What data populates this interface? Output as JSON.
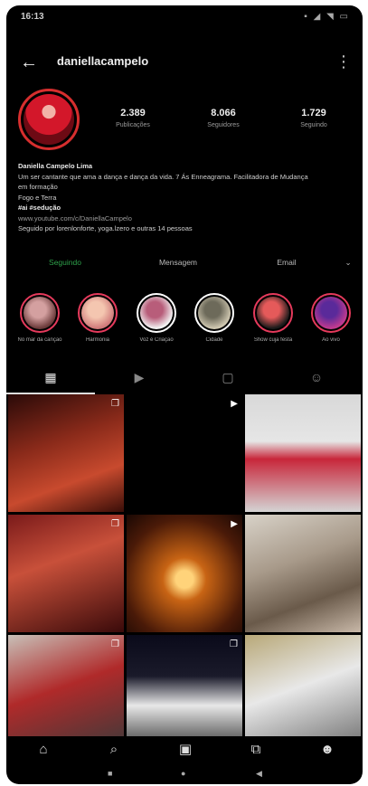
{
  "status_bar": {
    "time": "16:13",
    "icons": "▪ ◢ ◥ ▭"
  },
  "header": {
    "back_icon": "←",
    "username": "daniellacampelo",
    "menu_icon": "⋮"
  },
  "stats": [
    {
      "value": "2.389",
      "label": "Publicações"
    },
    {
      "value": "8.066",
      "label": "Seguidores"
    },
    {
      "value": "1.729",
      "label": "Seguindo"
    }
  ],
  "bio": {
    "name": "Daniella Campelo Lima",
    "lines": [
      "Um ser cantante que ama a dança e dança da vida. 7 Ás Enneagrama. Facilitadora de Mudança",
      "em formação",
      "Fogo e Terra"
    ],
    "linktitle": "#ai #sedução",
    "link": "www.youtube.com/c/DaniellaCampelo",
    "followed_by": "Seguido por lorenlonforte, yoga.lzero e outras 14 pessoas"
  },
  "buttons": {
    "follow": "Seguindo",
    "message": "Mensagem",
    "email": "Email",
    "more": "⌄"
  },
  "highlights": [
    {
      "caption": "No mar da canção",
      "colors": [
        "#6b3a3a",
        "#d4a0a0"
      ]
    },
    {
      "caption": "Harmonia",
      "colors": [
        "#d07a7a",
        "#f4c6b0"
      ]
    },
    {
      "caption": "Voz é Criação",
      "colors": [
        "#f2f2f2",
        "#b85d7a"
      ]
    },
    {
      "caption": "Cidade",
      "colors": [
        "#cfc7b0",
        "#6d6a5a"
      ]
    },
    {
      "caption": "Show cuja festa",
      "colors": [
        "#1a1a1a",
        "#e55a5a"
      ]
    },
    {
      "caption": "Ao vivo",
      "colors": [
        "#c23a8f",
        "#5a2a9a"
      ]
    }
  ],
  "tabs": [
    {
      "icon": "▦"
    },
    {
      "icon": "▶"
    },
    {
      "icon": "▢"
    },
    {
      "icon": "☺"
    }
  ],
  "grid": [
    {
      "badge": "❐",
      "bg": "linear-gradient(160deg,#2a0a08 0%,#8a2a1a 40%,#c84a2e 70%,#3a0e08 100%)"
    },
    {
      "badge": "▶",
      "bg": "#000000"
    },
    {
      "badge": "",
      "bg": "linear-gradient(180deg,#d8d8d8 0%,#e6e6e6 40%,#c8263a 55%,#d4d4d4 100%)"
    },
    {
      "badge": "❐",
      "bg": "linear-gradient(160deg,#7a1a1a 0%,#c8503a 40%,#3a0a0a 100%)"
    },
    {
      "badge": "▶",
      "bg": "radial-gradient(circle at 50% 55%,#ffd37a 0 10%,#c86414 25%,#4a1a08 70%,#1a0804 100%)"
    },
    {
      "badge": "",
      "bg": "linear-gradient(160deg,#d8d2c8 0%,#a89a8a 40%,#6a5a4a 70%,#c8b8a8 100%)"
    },
    {
      "badge": "❐",
      "bg": "linear-gradient(160deg,#c8c0b8 0%,#b02a2a 45%,#3a3a3a 100%)"
    },
    {
      "badge": "❐",
      "bg": "linear-gradient(180deg,#0a0a1a 0%,#1a1a2a 35%,#e8e8e8 60%,#2a2a2a 100%)"
    },
    {
      "badge": "",
      "bg": "linear-gradient(160deg,#b8a878 0%,#e8e8e8 45%,#6a6a6a 100%)"
    }
  ],
  "bottom_nav": [
    {
      "name": "home-icon",
      "glyph": "⌂"
    },
    {
      "name": "search-icon",
      "glyph": "⌕"
    },
    {
      "name": "reels-icon",
      "glyph": "▣"
    },
    {
      "name": "shop-icon",
      "glyph": "⧉"
    },
    {
      "name": "profile-icon",
      "glyph": "☻"
    }
  ],
  "system_nav": {
    "recent": "■",
    "home": "●",
    "back": "◀"
  },
  "colors": {
    "background": "#000000",
    "follow_green": "#2ea04a",
    "avatar_ring": "#d62e2e",
    "highlight_ring": "#e63a5c"
  }
}
